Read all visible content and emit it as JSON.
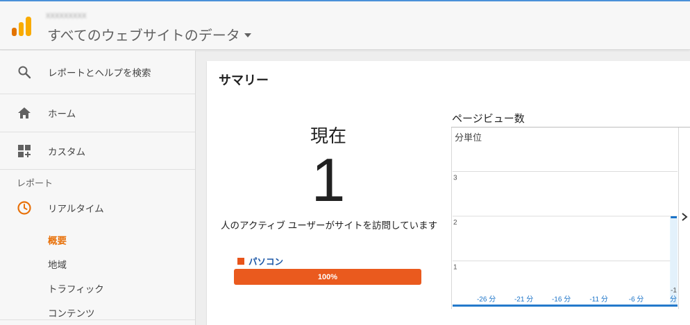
{
  "header": {
    "account_name": "xxxxxxxxx",
    "property_view": "すべてのウェブサイトのデータ"
  },
  "sidebar": {
    "search_label": "レポートとヘルプを検索",
    "home_label": "ホーム",
    "custom_label": "カスタム",
    "reports_heading": "レポート",
    "realtime_label": "リアルタイム",
    "realtime_items": [
      {
        "label": "概要",
        "active": true
      },
      {
        "label": "地域",
        "active": false
      },
      {
        "label": "トラフィック",
        "active": false
      },
      {
        "label": "コンテンツ",
        "active": false
      }
    ]
  },
  "summary": {
    "title": "サマリー",
    "now_label": "現在",
    "active_users": "1",
    "active_users_text": "人のアクティブ ユーザーがサイトを訪問しています",
    "device": {
      "name": "パソコン",
      "percent_label": "100%",
      "percent": 100
    }
  },
  "chart_data": {
    "type": "bar",
    "title": "ページビュー数",
    "ylabel": "分単位",
    "y_ticks": [
      "1",
      "2",
      "3"
    ],
    "ylim": [
      0,
      3.6
    ],
    "x_tick_labels": [
      "-26 分",
      "-21 分",
      "-16 分",
      "-11 分",
      "-6 分",
      "-1 分"
    ],
    "x": [
      -30,
      -29,
      -28,
      -27,
      -26,
      -25,
      -24,
      -23,
      -22,
      -21,
      -20,
      -19,
      -18,
      -17,
      -16,
      -15,
      -14,
      -13,
      -12,
      -11,
      -10,
      -9,
      -8,
      -7,
      -6,
      -5,
      -4,
      -3,
      -2,
      -1
    ],
    "values": [
      0,
      0,
      0,
      0,
      0,
      0,
      0,
      0,
      0,
      0,
      0,
      0,
      0,
      0,
      0,
      0,
      0,
      0,
      0,
      0,
      0,
      0,
      0,
      0,
      0,
      0,
      0,
      0,
      0,
      2
    ],
    "grid": true,
    "colors": {
      "bar": "#1a73c8",
      "axis_labels": "#1a73c8",
      "grid": "#dcdcdc",
      "highlight": "#e3f1fb"
    }
  },
  "colors": {
    "accent": "#e8710a",
    "bar": "#ea5a1e",
    "link": "#1a56a6"
  }
}
